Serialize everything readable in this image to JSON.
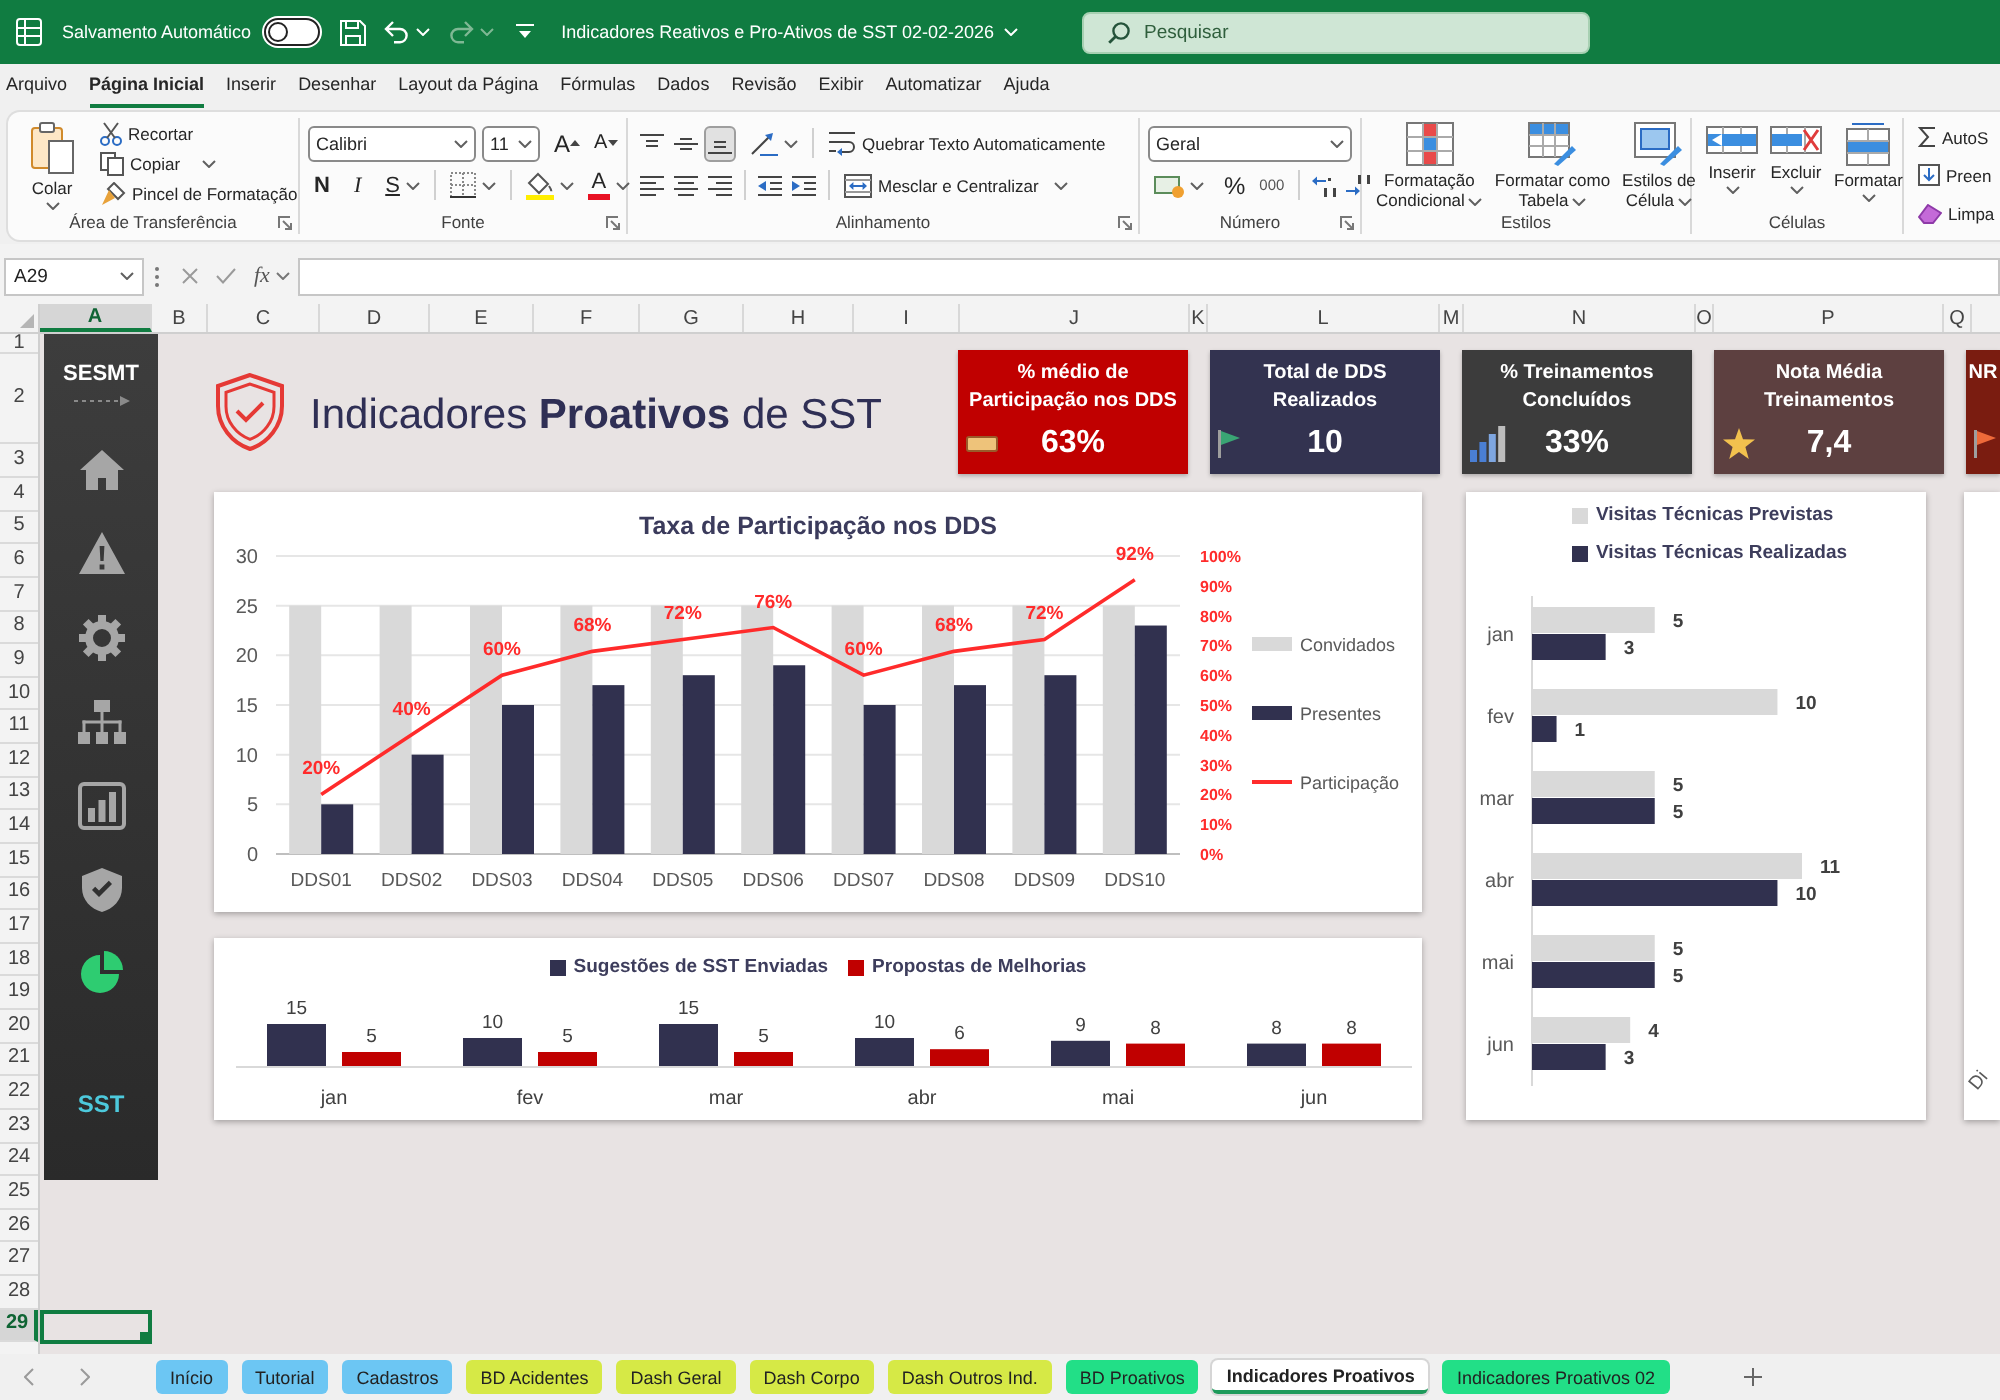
{
  "title_bar": {
    "autosave": {
      "label": "Salvamento Automático",
      "on": false
    },
    "document_title": "Indicadores Reativos e Pro-Ativos de SST 02-02-2026",
    "search": {
      "placeholder": "Pesquisar"
    }
  },
  "menu_tabs": [
    {
      "label": "Arquivo",
      "selected": false
    },
    {
      "label": "Página Inicial",
      "selected": true
    },
    {
      "label": "Inserir",
      "selected": false
    },
    {
      "label": "Desenhar",
      "selected": false
    },
    {
      "label": "Layout da Página",
      "selected": false
    },
    {
      "label": "Fórmulas",
      "selected": false
    },
    {
      "label": "Dados",
      "selected": false
    },
    {
      "label": "Revisão",
      "selected": false
    },
    {
      "label": "Exibir",
      "selected": false
    },
    {
      "label": "Automatizar",
      "selected": false
    },
    {
      "label": "Ajuda",
      "selected": false
    }
  ],
  "ribbon": {
    "clipboard": {
      "label": "Área de Transferência",
      "paste": "Colar",
      "cut": "Recortar",
      "copy": "Copiar",
      "format_painter": "Pincel de Formatação"
    },
    "font": {
      "label": "Fonte",
      "font_name": "Calibri",
      "font_size": "11",
      "grow_font": "A",
      "shrink_font": "A",
      "bold": "N",
      "italic": "I",
      "underline": "S",
      "font_color": "A"
    },
    "alignment": {
      "label": "Alinhamento",
      "vertical": [
        {
          "kind": "top",
          "selected": false
        },
        {
          "kind": "middle",
          "selected": false
        },
        {
          "kind": "bottom",
          "selected": true
        }
      ],
      "horizontal": [
        {
          "kind": "left",
          "selected": false
        },
        {
          "kind": "center",
          "selected": false
        },
        {
          "kind": "right",
          "selected": false
        }
      ],
      "wrap_text": "Quebrar Texto Automaticamente",
      "merge": "Mesclar e Centralizar"
    },
    "number": {
      "label": "Número",
      "format": "Geral",
      "percent": "%",
      "thousands": "000"
    },
    "styles": {
      "label": "Estilos",
      "buttons": [
        {
          "kind": "conditional",
          "label": "Formatação\nCondicional"
        },
        {
          "kind": "table",
          "label": "Formatar como\nTabela"
        },
        {
          "kind": "cell",
          "label": "Estilos de\nCélula"
        }
      ]
    },
    "cells": {
      "label": "Células",
      "buttons": [
        {
          "kind": "insert",
          "label": "Inserir"
        },
        {
          "kind": "delete",
          "label": "Excluir"
        },
        {
          "kind": "format",
          "label": "Formatar"
        }
      ]
    },
    "editing": {
      "buttons": [
        {
          "kind": "sum",
          "label": "AutoS"
        },
        {
          "kind": "fill",
          "label": "Preen"
        },
        {
          "kind": "clear",
          "label": "Limpa"
        }
      ]
    }
  },
  "formula_bar": {
    "name_box": "A29",
    "function_button": "fx"
  },
  "sheet": {
    "columns": [
      {
        "label": "A",
        "selected": true
      },
      {
        "label": "B",
        "selected": false
      },
      {
        "label": "C",
        "selected": false
      },
      {
        "label": "D",
        "selected": false
      },
      {
        "label": "E",
        "selected": false
      },
      {
        "label": "F",
        "selected": false
      },
      {
        "label": "G",
        "selected": false
      },
      {
        "label": "H",
        "selected": false
      },
      {
        "label": "I",
        "selected": false
      },
      {
        "label": "J",
        "selected": false
      },
      {
        "label": "K",
        "selected": false
      },
      {
        "label": "L",
        "selected": false
      },
      {
        "label": "M",
        "selected": false
      },
      {
        "label": "N",
        "selected": false
      },
      {
        "label": "O",
        "selected": false
      },
      {
        "label": "P",
        "selected": false
      },
      {
        "label": "Q",
        "selected": false
      }
    ],
    "rows": [
      {
        "label": "1",
        "selected": false
      },
      {
        "label": "2",
        "selected": false
      },
      {
        "label": "3",
        "selected": false
      },
      {
        "label": "4",
        "selected": false
      },
      {
        "label": "5",
        "selected": false
      },
      {
        "label": "6",
        "selected": false
      },
      {
        "label": "7",
        "selected": false
      },
      {
        "label": "8",
        "selected": false
      },
      {
        "label": "9",
        "selected": false
      },
      {
        "label": "10",
        "selected": false
      },
      {
        "label": "11",
        "selected": false
      },
      {
        "label": "12",
        "selected": false
      },
      {
        "label": "13",
        "selected": false
      },
      {
        "label": "14",
        "selected": false
      },
      {
        "label": "15",
        "selected": false
      },
      {
        "label": "16",
        "selected": false
      },
      {
        "label": "17",
        "selected": false
      },
      {
        "label": "18",
        "selected": false
      },
      {
        "label": "19",
        "selected": false
      },
      {
        "label": "20",
        "selected": false
      },
      {
        "label": "21",
        "selected": false
      },
      {
        "label": "22",
        "selected": false
      },
      {
        "label": "23",
        "selected": false
      },
      {
        "label": "24",
        "selected": false
      },
      {
        "label": "25",
        "selected": false
      },
      {
        "label": "26",
        "selected": false
      },
      {
        "label": "27",
        "selected": false
      },
      {
        "label": "28",
        "selected": false
      },
      {
        "label": "29",
        "selected": true
      }
    ]
  },
  "dashboard": {
    "sidebar": {
      "title": "SESMT",
      "items": [
        {
          "kind": "home",
          "selected": false
        },
        {
          "kind": "alert",
          "selected": false
        },
        {
          "kind": "settings",
          "selected": false
        },
        {
          "kind": "hierarchy",
          "selected": false
        },
        {
          "kind": "chart",
          "selected": false
        },
        {
          "kind": "shield",
          "selected": false
        },
        {
          "kind": "pie",
          "selected": true
        }
      ],
      "footer": "SST"
    },
    "heading": "Indicadores **Proativos** de SST",
    "cards": [
      {
        "kind": "participation",
        "title": "% médio de\nParticipação nos DDS",
        "value": "63%",
        "color": "#c00000"
      },
      {
        "kind": "count",
        "title": "Total de DDS\nRealizados",
        "value": "10",
        "color": "#333350"
      },
      {
        "kind": "training",
        "title": "% Treinamentos\nConcluídos",
        "value": "33%",
        "color": "#3c3c3c"
      },
      {
        "kind": "rating",
        "title": "Nota Média\nTreinamentos",
        "value": "7,4",
        "color": "#5d4040"
      },
      {
        "kind": "nr",
        "title": "NR",
        "color": "#7a1c10"
      }
    ],
    "participation_chart": {
      "chart_data": {
        "type": "bar",
        "title": "Taxa de Participação nos DDS",
        "categories": [
          "DDS01",
          "DDS02",
          "DDS03",
          "DDS04",
          "DDS05",
          "DDS06",
          "DDS07",
          "DDS08",
          "DDS09",
          "DDS10"
        ],
        "series": [
          {
            "name": "Convidados",
            "color": "#d9d9d9",
            "values": [
              25,
              25,
              25,
              25,
              25,
              25,
              25,
              25,
              25,
              25
            ]
          },
          {
            "name": "Presentes",
            "color": "#31314f",
            "values": [
              5,
              10,
              15,
              17,
              18,
              19,
              15,
              17,
              18,
              23
            ]
          },
          {
            "name": "Participação",
            "color": "#ff2b2b",
            "type": "line",
            "axis": "y2",
            "values": [
              20,
              40,
              60,
              68,
              72,
              76,
              60,
              68,
              72,
              92
            ],
            "value_labels": [
              "20%",
              "40%",
              "60%",
              "68%",
              "72%",
              "76%",
              "60%",
              "68%",
              "72%",
              "92%"
            ]
          }
        ],
        "ylim": [
          0,
          30
        ],
        "yticks": [
          0,
          5,
          10,
          15,
          20,
          25,
          30
        ],
        "y2lim": [
          0,
          100
        ],
        "y2ticks": [
          {
            "value": 0,
            "label": "0%"
          },
          {
            "value": 10,
            "label": "10%"
          },
          {
            "value": 20,
            "label": "20%"
          },
          {
            "value": 30,
            "label": "30%"
          },
          {
            "value": 40,
            "label": "40%"
          },
          {
            "value": 50,
            "label": "50%"
          },
          {
            "value": 60,
            "label": "60%"
          },
          {
            "value": 70,
            "label": "70%"
          },
          {
            "value": 80,
            "label": "80%"
          },
          {
            "value": 90,
            "label": "90%"
          },
          {
            "value": 100,
            "label": "100%"
          }
        ],
        "grid": true,
        "legend": "right"
      }
    },
    "suggestions_chart": {
      "chart_data": {
        "type": "bar",
        "categories": [
          "jan",
          "fev",
          "mar",
          "abr",
          "mai",
          "jun"
        ],
        "series": [
          {
            "name": "Sugestões de SST Enviadas",
            "color": "#31314f",
            "values": [
              15,
              10,
              15,
              10,
              9,
              8
            ]
          },
          {
            "name": "Propostas de Melhorias",
            "color": "#c00000",
            "values": [
              5,
              5,
              5,
              6,
              8,
              8
            ]
          }
        ],
        "data_labels": true,
        "legend": "top"
      }
    },
    "visits_chart": {
      "chart_data": {
        "type": "bar",
        "orientation": "horizontal",
        "categories": [
          "jan",
          "fev",
          "mar",
          "abr",
          "mai",
          "jun"
        ],
        "series": [
          {
            "name": "Visitas Técnicas Previstas",
            "color": "#d9d9d9",
            "values": [
              5,
              10,
              5,
              11,
              5,
              4
            ]
          },
          {
            "name": "Visitas Técnicas Realizadas",
            "color": "#31314f",
            "values": [
              3,
              1,
              5,
              10,
              5,
              3
            ]
          }
        ],
        "data_labels": true,
        "legend": "top"
      }
    },
    "chart_4": {
      "label": "Di"
    }
  },
  "sheet_tabs": [
    {
      "label": "Início",
      "color": "#6cc6f3",
      "selected": false
    },
    {
      "label": "Tutorial",
      "color": "#6cc6f3",
      "selected": false
    },
    {
      "label": "Cadastros",
      "color": "#6cc6f3",
      "selected": false
    },
    {
      "label": "BD Acidentes",
      "color": "#d6e946",
      "selected": false
    },
    {
      "label": "Dash Geral",
      "color": "#d6e946",
      "selected": false
    },
    {
      "label": "Dash Corpo",
      "color": "#d6e946",
      "selected": false
    },
    {
      "label": "Dash Outros Ind.",
      "color": "#d6e946",
      "selected": false
    },
    {
      "label": "BD Proativos",
      "color": "#22df87",
      "selected": false
    },
    {
      "label": "Indicadores Proativos",
      "color": "#1d9a5a",
      "selected": true
    },
    {
      "label": "Indicadores Proativos 02",
      "color": "#22df87",
      "selected": false
    }
  ]
}
